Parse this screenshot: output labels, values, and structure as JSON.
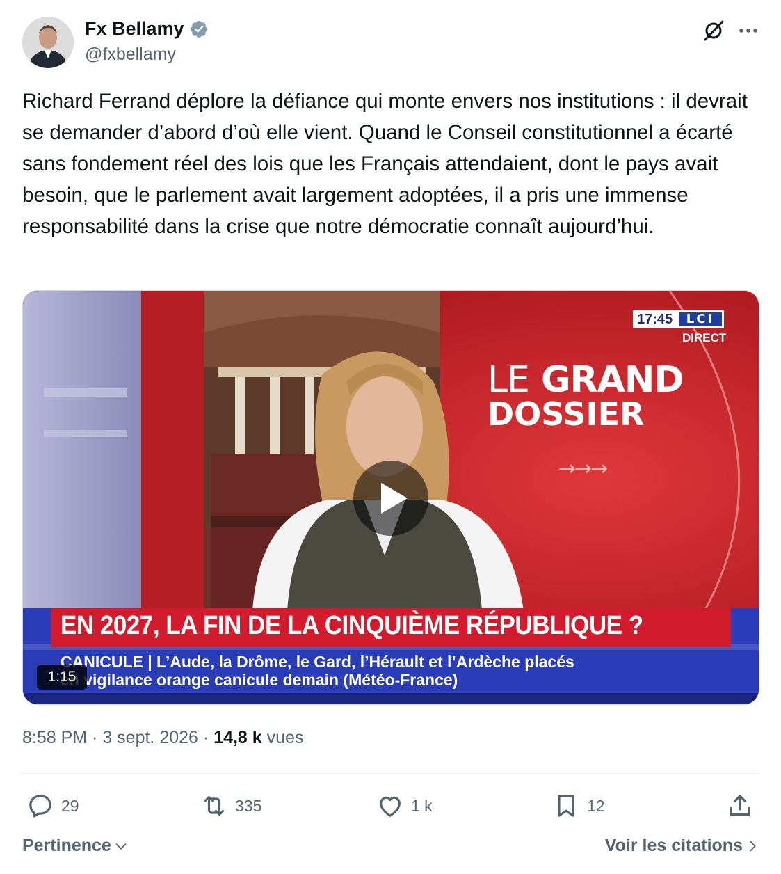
{
  "author": {
    "display_name": "Fx Bellamy",
    "handle": "@fxbellamy",
    "verified_icon": "verified-badge-icon"
  },
  "header_icons": [
    "grok-icon",
    "more-icon"
  ],
  "tweet": {
    "text": "Richard Ferrand déplore la défiance qui monte envers nos institutions : il devrait se demander d’abord d’où elle vient. Quand le Conseil constitutionnel a écarté sans fondement réel des lois que les Français attendaient, dont le pays avait besoin, que le parlement avait largement adoptées, il a pris une immense responsabilité dans la crise que notre démocratie connaît aujourd’hui."
  },
  "video": {
    "clock": "17:45",
    "channel": "LCI",
    "live_label": "DIRECT",
    "show_title_line1_a": "LE",
    "show_title_line1_b": "GRAND",
    "show_title_line2": "DOSSIER",
    "arrows": "→→→",
    "headline": "EN 2027, LA FIN DE LA CINQUIÈME RÉPUBLIQUE ?",
    "ticker_line1": "CANICULE | L’Aude, la Drôme, le Gard, l’Hérault et l’Ardèche placés",
    "ticker_line2": "en vigilance orange canicule demain (Météo-France)",
    "duration": "1:15",
    "colors": {
      "background": "#c7232a",
      "headline_band": "#d31b2e",
      "ticker_band": "#2a3cb8"
    }
  },
  "meta": {
    "time": "8:58 PM",
    "separator": " · ",
    "date": "3 sept. 2026",
    "views_count": "14,8 k",
    "views_label": "vues"
  },
  "actions": {
    "replies": "29",
    "reposts": "335",
    "likes": "1 k",
    "bookmarks": "12"
  },
  "footer": {
    "sort_label": "Pertinence",
    "quotes_link": "Voir les citations"
  }
}
